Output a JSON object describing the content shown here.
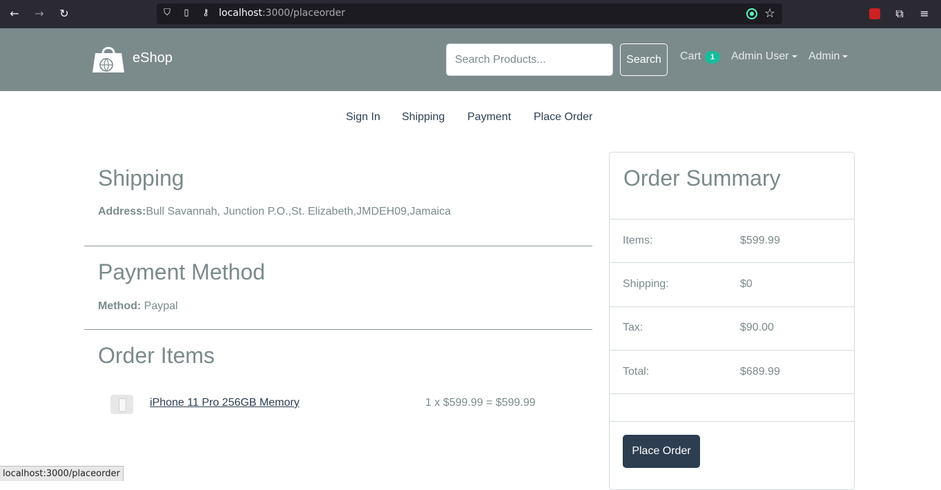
{
  "browser": {
    "url_host": "localhost",
    "url_path": ":3000/placeorder",
    "status_url": "localhost:3000/placeorder"
  },
  "navbar": {
    "brand": "eShop",
    "search_placeholder": "Search Products...",
    "search_button": "Search",
    "cart_label": "Cart",
    "cart_count": "1",
    "user_menu": "Admin User",
    "admin_menu": "Admin"
  },
  "steps": [
    "Sign In",
    "Shipping",
    "Payment",
    "Place Order"
  ],
  "shipping": {
    "heading": "Shipping",
    "address_label": "Address:",
    "address_value": "Bull Savannah, Junction P.O.,St. Elizabeth,JMDEH09,Jamaica"
  },
  "payment": {
    "heading": "Payment Method",
    "method_label": "Method:",
    "method_value": " Paypal"
  },
  "order_items": {
    "heading": "Order Items",
    "items": [
      {
        "name": "iPhone 11 Pro 256GB Memory",
        "price_line": "1 x $599.99 = $599.99"
      }
    ]
  },
  "summary": {
    "title": "Order Summary",
    "rows": [
      {
        "label": "Items:",
        "value": "$599.99"
      },
      {
        "label": "Shipping:",
        "value": "$0"
      },
      {
        "label": "Tax:",
        "value": "$90.00"
      },
      {
        "label": "Total:",
        "value": "$689.99"
      }
    ],
    "button": "Place Order"
  }
}
